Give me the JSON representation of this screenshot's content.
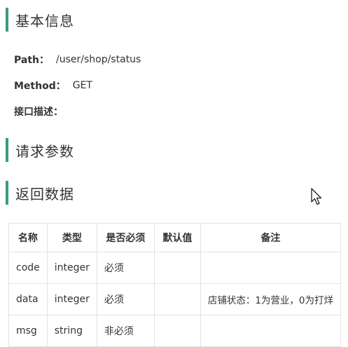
{
  "sections": {
    "basic_info": "基本信息",
    "request_params": "请求参数",
    "response_data": "返回数据"
  },
  "basic": {
    "path_label": "Path：",
    "path_value": "/user/shop/status",
    "method_label": "Method：",
    "method_value": "GET",
    "desc_label": "接口描述："
  },
  "table": {
    "headers": [
      "名称",
      "类型",
      "是否必须",
      "默认值",
      "备注"
    ],
    "rows": [
      [
        "code",
        "integer",
        "必须",
        "",
        ""
      ],
      [
        "data",
        "integer",
        "必须",
        "",
        "店铺状态：1为营业，0为打烊"
      ],
      [
        "msg",
        "string",
        "非必须",
        "",
        ""
      ]
    ]
  },
  "colors": {
    "accent": "#3a9b7a",
    "border": "#dfe2e5"
  },
  "icons": {
    "cursor": "mouse-pointer-icon"
  }
}
